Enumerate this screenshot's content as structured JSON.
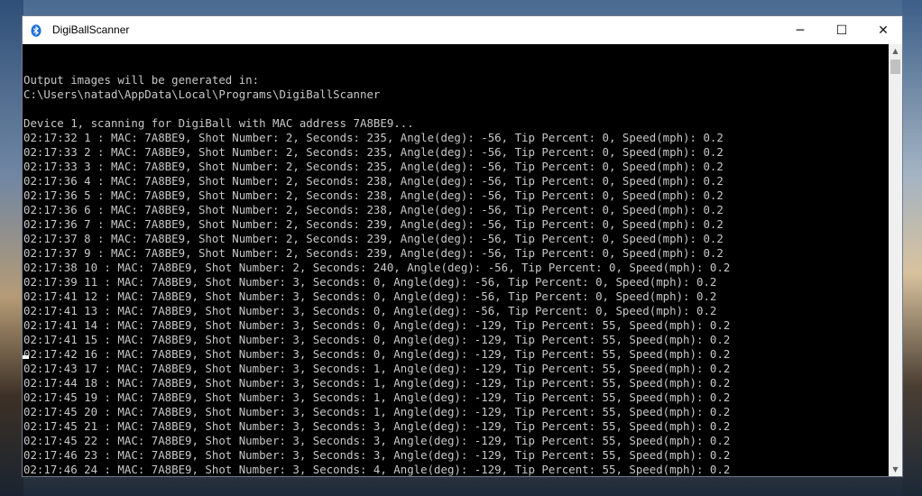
{
  "window": {
    "title": "DigiBallScanner",
    "icon": "bluetooth-icon",
    "buttons": {
      "minimize": "─",
      "maximize": "☐",
      "close": "✕"
    }
  },
  "console": {
    "lines": [
      "",
      "Output images will be generated in:",
      "C:\\Users\\natad\\AppData\\Local\\Programs\\DigiBallScanner",
      "",
      "Device 1, scanning for DigiBall with MAC address 7A8BE9...",
      "02:17:32 1 : MAC: 7A8BE9, Shot Number: 2, Seconds: 235, Angle(deg): -56, Tip Percent: 0, Speed(mph): 0.2",
      "02:17:33 2 : MAC: 7A8BE9, Shot Number: 2, Seconds: 235, Angle(deg): -56, Tip Percent: 0, Speed(mph): 0.2",
      "02:17:33 3 : MAC: 7A8BE9, Shot Number: 2, Seconds: 235, Angle(deg): -56, Tip Percent: 0, Speed(mph): 0.2",
      "02:17:36 4 : MAC: 7A8BE9, Shot Number: 2, Seconds: 238, Angle(deg): -56, Tip Percent: 0, Speed(mph): 0.2",
      "02:17:36 5 : MAC: 7A8BE9, Shot Number: 2, Seconds: 238, Angle(deg): -56, Tip Percent: 0, Speed(mph): 0.2",
      "02:17:36 6 : MAC: 7A8BE9, Shot Number: 2, Seconds: 238, Angle(deg): -56, Tip Percent: 0, Speed(mph): 0.2",
      "02:17:36 7 : MAC: 7A8BE9, Shot Number: 2, Seconds: 239, Angle(deg): -56, Tip Percent: 0, Speed(mph): 0.2",
      "02:17:37 8 : MAC: 7A8BE9, Shot Number: 2, Seconds: 239, Angle(deg): -56, Tip Percent: 0, Speed(mph): 0.2",
      "02:17:37 9 : MAC: 7A8BE9, Shot Number: 2, Seconds: 239, Angle(deg): -56, Tip Percent: 0, Speed(mph): 0.2",
      "02:17:38 10 : MAC: 7A8BE9, Shot Number: 2, Seconds: 240, Angle(deg): -56, Tip Percent: 0, Speed(mph): 0.2",
      "02:17:39 11 : MAC: 7A8BE9, Shot Number: 3, Seconds: 0, Angle(deg): -56, Tip Percent: 0, Speed(mph): 0.2",
      "02:17:41 12 : MAC: 7A8BE9, Shot Number: 3, Seconds: 0, Angle(deg): -56, Tip Percent: 0, Speed(mph): 0.2",
      "02:17:41 13 : MAC: 7A8BE9, Shot Number: 3, Seconds: 0, Angle(deg): -56, Tip Percent: 0, Speed(mph): 0.2",
      "02:17:41 14 : MAC: 7A8BE9, Shot Number: 3, Seconds: 0, Angle(deg): -129, Tip Percent: 55, Speed(mph): 0.2",
      "02:17:41 15 : MAC: 7A8BE9, Shot Number: 3, Seconds: 0, Angle(deg): -129, Tip Percent: 55, Speed(mph): 0.2",
      "02:17:42 16 : MAC: 7A8BE9, Shot Number: 3, Seconds: 0, Angle(deg): -129, Tip Percent: 55, Speed(mph): 0.2",
      "02:17:43 17 : MAC: 7A8BE9, Shot Number: 3, Seconds: 1, Angle(deg): -129, Tip Percent: 55, Speed(mph): 0.2",
      "02:17:44 18 : MAC: 7A8BE9, Shot Number: 3, Seconds: 1, Angle(deg): -129, Tip Percent: 55, Speed(mph): 0.2",
      "02:17:45 19 : MAC: 7A8BE9, Shot Number: 3, Seconds: 1, Angle(deg): -129, Tip Percent: 55, Speed(mph): 0.2",
      "02:17:45 20 : MAC: 7A8BE9, Shot Number: 3, Seconds: 1, Angle(deg): -129, Tip Percent: 55, Speed(mph): 0.2",
      "02:17:45 21 : MAC: 7A8BE9, Shot Number: 3, Seconds: 3, Angle(deg): -129, Tip Percent: 55, Speed(mph): 0.2",
      "02:17:45 22 : MAC: 7A8BE9, Shot Number: 3, Seconds: 3, Angle(deg): -129, Tip Percent: 55, Speed(mph): 0.2",
      "02:17:46 23 : MAC: 7A8BE9, Shot Number: 3, Seconds: 3, Angle(deg): -129, Tip Percent: 55, Speed(mph): 0.2",
      "02:17:46 24 : MAC: 7A8BE9, Shot Number: 3, Seconds: 4, Angle(deg): -129, Tip Percent: 55, Speed(mph): 0.2"
    ]
  },
  "scrollbar": {
    "up_arrow": "▲",
    "down_arrow": "▼"
  },
  "colors": {
    "console_bg": "#000000",
    "console_text": "#c8c8c8",
    "titlebar_bg": "#ffffff",
    "icon_blue": "#1e6fd9"
  }
}
